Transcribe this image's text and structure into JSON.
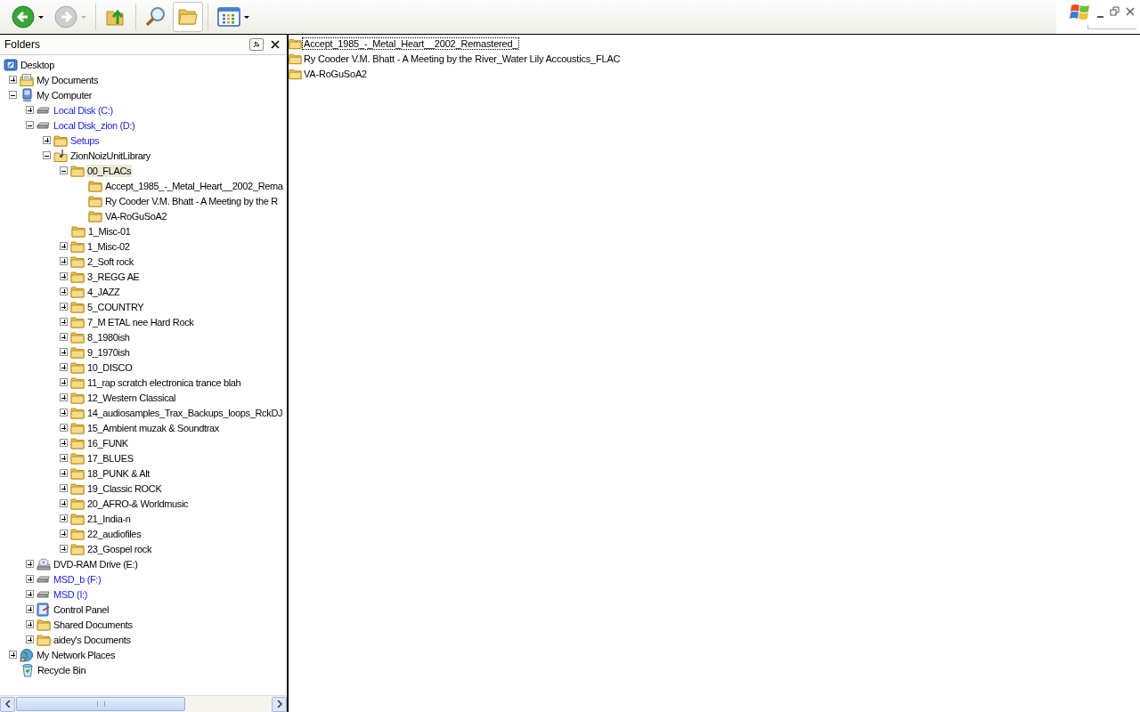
{
  "toolbar": {
    "buttons": [
      {
        "kind": "back",
        "selected": false,
        "disabled": false,
        "caret": true
      },
      {
        "kind": "forward",
        "selected": false,
        "disabled": true,
        "caret": true
      },
      {
        "kind": "up",
        "selected": false,
        "disabled": false,
        "caret": false
      },
      {
        "kind": "search",
        "selected": false,
        "disabled": false,
        "caret": false
      },
      {
        "kind": "folders",
        "selected": true,
        "disabled": false,
        "caret": false
      },
      {
        "kind": "views",
        "selected": false,
        "disabled": false,
        "caret": true
      }
    ]
  },
  "folders_pane": {
    "title": "Folders",
    "tree": [
      {
        "label": "Desktop",
        "kind": "desktop",
        "selected": false,
        "compressed": false,
        "children": [
          {
            "label": "My Documents",
            "kind": "documents",
            "expanded": false,
            "selected": false,
            "compressed": false
          },
          {
            "label": "My Computer",
            "kind": "computer",
            "expanded": true,
            "selected": false,
            "compressed": false,
            "children": [
              {
                "label": "Local Disk (C:)",
                "kind": "drive",
                "expanded": false,
                "selected": false,
                "compressed": true
              },
              {
                "label": "Local Disk_zion (D:)",
                "kind": "drive",
                "expanded": true,
                "selected": false,
                "compressed": true,
                "children": [
                  {
                    "label": "Setups",
                    "kind": "folder",
                    "expanded": false,
                    "selected": false,
                    "compressed": true
                  },
                  {
                    "label": "ZionNoizUnitLibrary",
                    "kind": "music-folder",
                    "expanded": true,
                    "selected": false,
                    "compressed": false,
                    "children": [
                      {
                        "label": "00_FLACs",
                        "kind": "folder",
                        "expanded": true,
                        "selected": true,
                        "compressed": false,
                        "children": [
                          {
                            "label": "Accept_1985_-_Metal_Heart__2002_Rema",
                            "kind": "folder",
                            "selected": false,
                            "compressed": false
                          },
                          {
                            "label": "Ry Cooder V.M. Bhatt - A Meeting by the R",
                            "kind": "folder",
                            "selected": false,
                            "compressed": false
                          },
                          {
                            "label": "VA-RoGuSoA2",
                            "kind": "folder",
                            "selected": false,
                            "compressed": false
                          }
                        ]
                      },
                      {
                        "label": "1_Misc-01",
                        "kind": "folder",
                        "selected": false,
                        "compressed": false
                      },
                      {
                        "label": "1_Misc-02",
                        "kind": "folder",
                        "expanded": false,
                        "selected": false,
                        "compressed": false
                      },
                      {
                        "label": "2_Soft rock",
                        "kind": "folder",
                        "expanded": false,
                        "selected": false,
                        "compressed": false
                      },
                      {
                        "label": "3_REGG AE",
                        "kind": "folder",
                        "expanded": false,
                        "selected": false,
                        "compressed": false
                      },
                      {
                        "label": "4_JAZZ",
                        "kind": "folder",
                        "expanded": false,
                        "selected": false,
                        "compressed": false
                      },
                      {
                        "label": "5_COUNTRY",
                        "kind": "folder",
                        "expanded": false,
                        "selected": false,
                        "compressed": false
                      },
                      {
                        "label": "7_M ETAL nee Hard Rock",
                        "kind": "folder",
                        "expanded": false,
                        "selected": false,
                        "compressed": false
                      },
                      {
                        "label": "8_1980ish",
                        "kind": "folder",
                        "expanded": false,
                        "selected": false,
                        "compressed": false
                      },
                      {
                        "label": "9_1970ish",
                        "kind": "folder",
                        "expanded": false,
                        "selected": false,
                        "compressed": false
                      },
                      {
                        "label": "10_DISCO",
                        "kind": "folder",
                        "expanded": false,
                        "selected": false,
                        "compressed": false
                      },
                      {
                        "label": "11_rap scratch electronica trance blah",
                        "kind": "folder",
                        "expanded": false,
                        "selected": false,
                        "compressed": false
                      },
                      {
                        "label": "12_Western Classical",
                        "kind": "folder",
                        "expanded": false,
                        "selected": false,
                        "compressed": false
                      },
                      {
                        "label": "14_audiosamples_Trax_Backups_loops_RckDJ",
                        "kind": "folder",
                        "expanded": false,
                        "selected": false,
                        "compressed": false
                      },
                      {
                        "label": "15_Ambient muzak & Soundtrax",
                        "kind": "folder",
                        "expanded": false,
                        "selected": false,
                        "compressed": false
                      },
                      {
                        "label": "16_FUNK",
                        "kind": "folder",
                        "expanded": false,
                        "selected": false,
                        "compressed": false
                      },
                      {
                        "label": "17_BLUES",
                        "kind": "folder",
                        "expanded": false,
                        "selected": false,
                        "compressed": false
                      },
                      {
                        "label": "18_PUNK & Alt",
                        "kind": "folder",
                        "expanded": false,
                        "selected": false,
                        "compressed": false
                      },
                      {
                        "label": "19_Classic ROCK",
                        "kind": "folder",
                        "expanded": false,
                        "selected": false,
                        "compressed": false
                      },
                      {
                        "label": "20_AFRO-& Worldmusic",
                        "kind": "folder",
                        "expanded": false,
                        "selected": false,
                        "compressed": false
                      },
                      {
                        "label": "21_India-n",
                        "kind": "folder",
                        "expanded": false,
                        "selected": false,
                        "compressed": false
                      },
                      {
                        "label": "22_audiofiles",
                        "kind": "folder",
                        "expanded": false,
                        "selected": false,
                        "compressed": false
                      },
                      {
                        "label": "23_Gospel rock",
                        "kind": "folder",
                        "expanded": false,
                        "selected": false,
                        "compressed": false
                      }
                    ]
                  }
                ]
              },
              {
                "label": "DVD-RAM Drive (E:)",
                "kind": "dvd",
                "expanded": false,
                "selected": false,
                "compressed": false
              },
              {
                "label": "MSD_b (F:)",
                "kind": "drive",
                "expanded": false,
                "selected": false,
                "compressed": true
              },
              {
                "label": "MSD (I:)",
                "kind": "drive",
                "expanded": false,
                "selected": false,
                "compressed": true
              },
              {
                "label": "Control Panel",
                "kind": "control-panel",
                "expanded": false,
                "selected": false,
                "compressed": false
              },
              {
                "label": "Shared Documents",
                "kind": "folder",
                "expanded": false,
                "selected": false,
                "compressed": false
              },
              {
                "label": "aidey's Documents",
                "kind": "folder",
                "expanded": false,
                "selected": false,
                "compressed": false
              }
            ]
          },
          {
            "label": "My Network Places",
            "kind": "network",
            "expanded": false,
            "selected": false,
            "compressed": false
          },
          {
            "label": "Recycle Bin",
            "kind": "recycle",
            "selected": false,
            "compressed": false
          }
        ]
      }
    ]
  },
  "content": {
    "items": [
      {
        "name": "Accept_1985_-_Metal_Heart__2002_Remastered_",
        "focused": true
      },
      {
        "name": "Ry Cooder V.M. Bhatt - A Meeting by the River_Water Lily Accoustics_FLAC",
        "focused": false
      },
      {
        "name": "VA-RoGuSoA2",
        "focused": false
      }
    ]
  }
}
